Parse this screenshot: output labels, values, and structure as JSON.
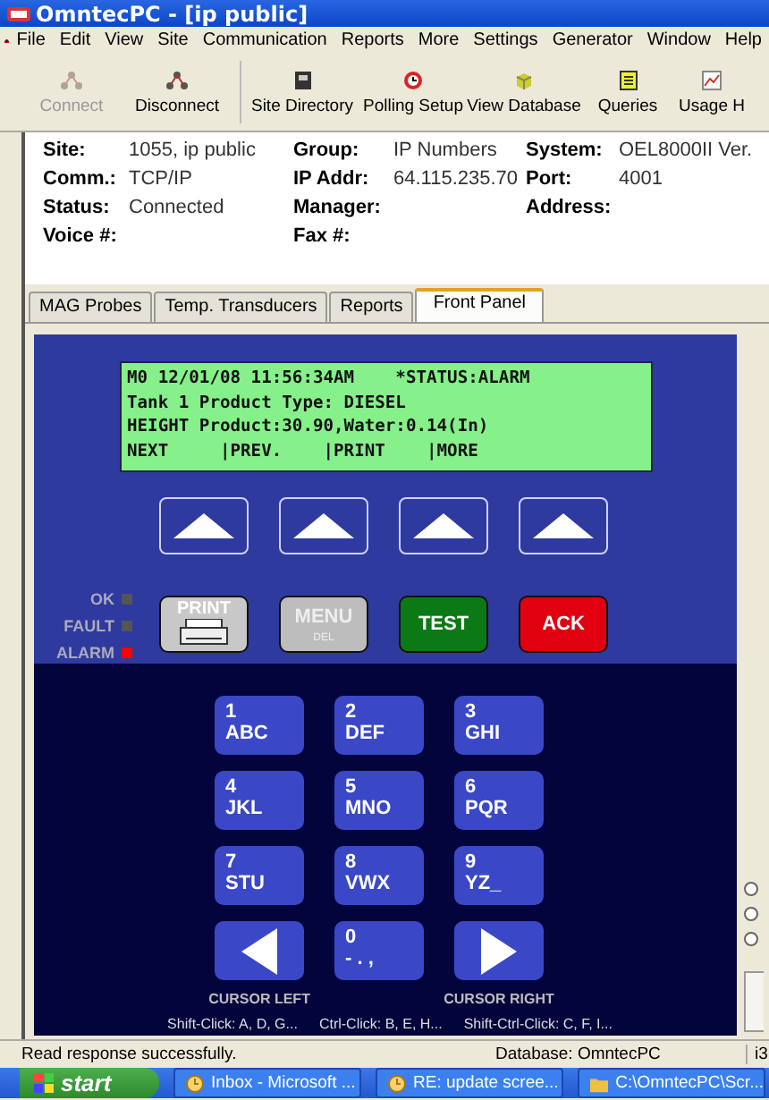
{
  "window": {
    "title": "OmntecPC - [ip public]"
  },
  "menu": [
    "File",
    "Edit",
    "View",
    "Site",
    "Communication",
    "Reports",
    "More",
    "Settings",
    "Generator",
    "Window",
    "Help"
  ],
  "toolbar": [
    {
      "label": "Connect",
      "kind": "nodes",
      "disabled": true
    },
    {
      "label": "Disconnect",
      "kind": "nodes",
      "disabled": false
    },
    {
      "label": "Site Directory",
      "kind": "book",
      "disabled": false
    },
    {
      "label": "Polling Setup",
      "kind": "clock",
      "disabled": false
    },
    {
      "label": "View Database",
      "kind": "cube",
      "disabled": false
    },
    {
      "label": "Queries",
      "kind": "list",
      "disabled": false
    },
    {
      "label": "Usage H",
      "kind": "chart",
      "disabled": false
    }
  ],
  "site_info": [
    {
      "label": "Site:",
      "value": "1055, ip public"
    },
    {
      "label": "Group:",
      "value": "IP Numbers"
    },
    {
      "label": "System:",
      "value": "OEL8000II Ver."
    },
    {
      "label": "Comm.:",
      "value": "TCP/IP"
    },
    {
      "label": "IP Addr:",
      "value": "64.115.235.70"
    },
    {
      "label": "Port:",
      "value": "4001"
    },
    {
      "label": "Status:",
      "value": "Connected"
    },
    {
      "label": "Manager:"
    },
    {
      "label": "Address:"
    },
    {
      "label": "Voice #:"
    },
    {
      "label": "Fax #:"
    }
  ],
  "tabs": [
    {
      "label": "MAG Probes",
      "selected": false
    },
    {
      "label": "Temp. Transducers",
      "selected": false
    },
    {
      "label": "Reports",
      "selected": false
    },
    {
      "label": "Front Panel",
      "selected": true
    }
  ],
  "display": {
    "lines": [
      "M0 12/01/08 11:56:34AM    *STATUS:ALARM",
      "Tank 1 Product Type: DIESEL",
      "HEIGHT Product:30.90,Water:0.14(In)",
      "NEXT     |PREV.    |PRINT    |MORE"
    ]
  },
  "leds": [
    {
      "label": "OK",
      "on": false
    },
    {
      "label": "FAULT",
      "on": false
    },
    {
      "label": "ALARM",
      "on": true
    }
  ],
  "panel_buttons": [
    {
      "kind": "print",
      "label": "PRINT"
    },
    {
      "kind": "menu",
      "label": "MENU",
      "sublabel": "DEL"
    },
    {
      "kind": "test",
      "label": "TEST"
    },
    {
      "kind": "ack",
      "label": "ACK"
    }
  ],
  "keypad": [
    {
      "kind": "digit",
      "number": "1",
      "letters": "ABC"
    },
    {
      "kind": "digit",
      "number": "2",
      "letters": "DEF"
    },
    {
      "kind": "digit",
      "number": "3",
      "letters": "GHI"
    },
    {
      "kind": "digit",
      "number": "4",
      "letters": "JKL"
    },
    {
      "kind": "digit",
      "number": "5",
      "letters": "MNO"
    },
    {
      "kind": "digit",
      "number": "6",
      "letters": "PQR"
    },
    {
      "kind": "digit",
      "number": "7",
      "letters": "STU"
    },
    {
      "kind": "digit",
      "number": "8",
      "letters": "VWX"
    },
    {
      "kind": "digit",
      "number": "9",
      "letters": "YZ_"
    },
    {
      "kind": "cursor_left",
      "caption": "CURSOR LEFT"
    },
    {
      "kind": "digit",
      "number": "0",
      "letters": "- . ,"
    },
    {
      "kind": "cursor_right",
      "caption": "CURSOR RIGHT"
    }
  ],
  "hints": [
    "Shift-Click: A, D, G...",
    "Ctrl-Click: B, E, H...",
    "Shift-Ctrl-Click: C, F, I..."
  ],
  "side_radios": [
    {
      "selected": false
    },
    {
      "selected": false
    },
    {
      "selected": false
    }
  ],
  "status_bar": {
    "message": "Read response successfully.",
    "database": "Database: OmntecPC",
    "extra": "i3"
  },
  "taskbar": {
    "start": "start",
    "tasks": [
      {
        "label": "Inbox - Microsoft ...",
        "kind": "mail"
      },
      {
        "label": "RE: update scree...",
        "kind": "mail"
      },
      {
        "label": "C:\\OmntecPC\\Scr...",
        "kind": "folder"
      }
    ]
  }
}
